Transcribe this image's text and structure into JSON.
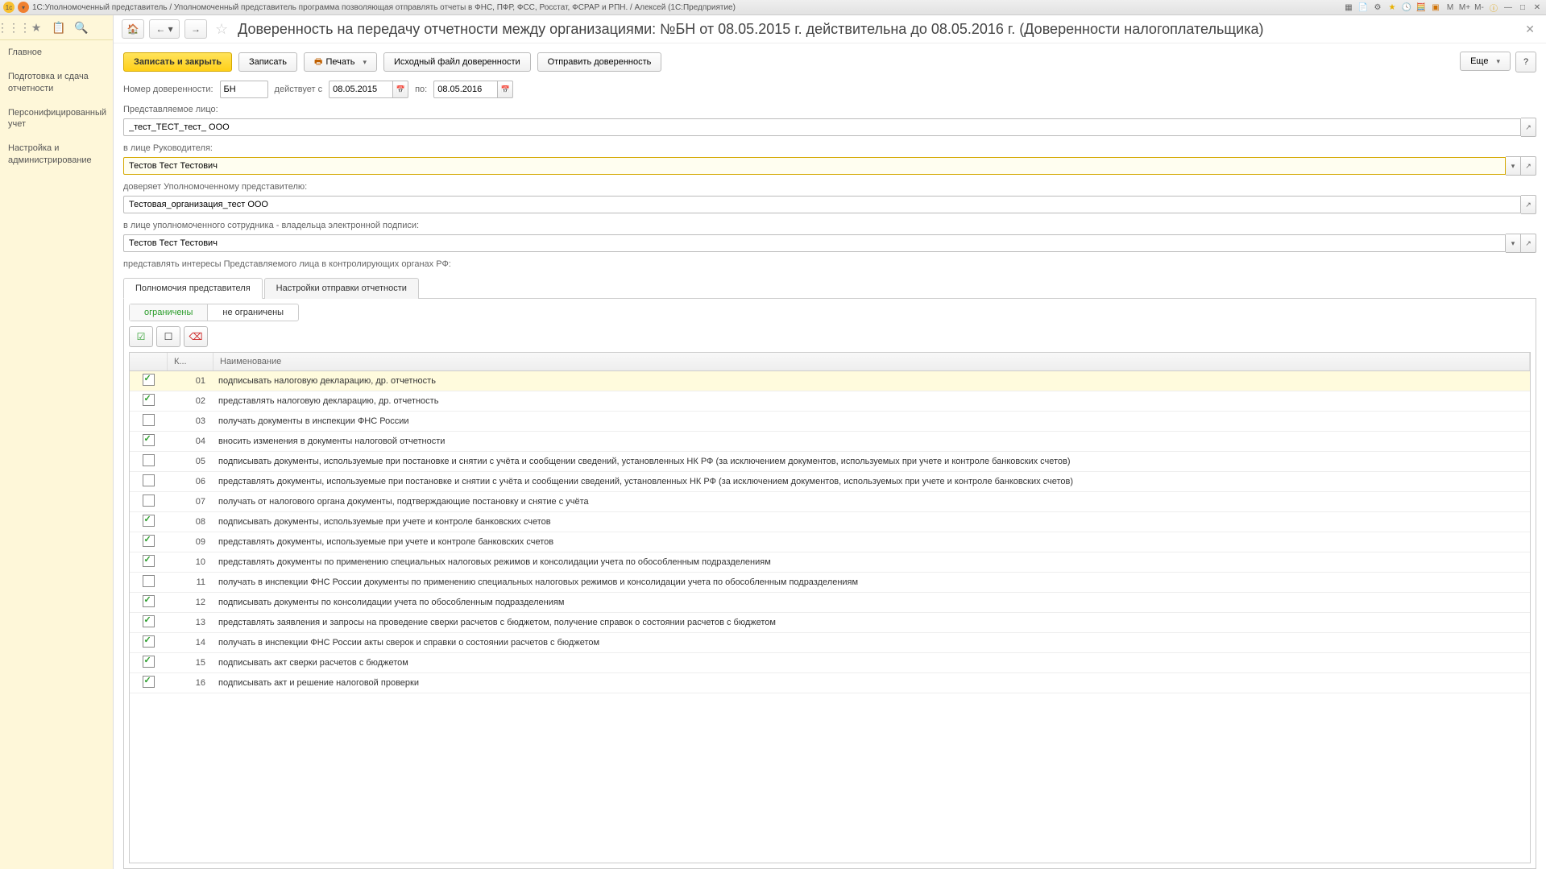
{
  "window": {
    "title": "1С:Уполномоченный представитель / Уполномоченный представитель программа позволяющая отправлять отчеты в ФНС, ПФР, ФСС, Росстат, ФСРАР и РПН. / Алексей  (1С:Предприятие)",
    "mlabels": [
      "M",
      "M+",
      "M-"
    ]
  },
  "sidebar": {
    "items": [
      "Главное",
      "Подготовка и сдача отчетности",
      "Персонифицированный учет",
      "Настройка и администрирование"
    ]
  },
  "page": {
    "title": "Доверенность на передачу отчетности между организациями: №БН от 08.05.2015 г. действительна до 08.05.2016 г. (Доверенности налогоплательщика)"
  },
  "toolbar": {
    "save_close": "Записать и закрыть",
    "save": "Записать",
    "print": "Печать",
    "source": "Исходный файл доверенности",
    "send": "Отправить доверенность",
    "more": "Еще"
  },
  "form": {
    "num_label": "Номер доверенности:",
    "num": "БН",
    "from_label": "действует с",
    "from": "08.05.2015",
    "to_label": "по:",
    "to": "08.05.2016",
    "org_label": "Представляемое лицо:",
    "org": "_тест_ТЕСТ_тест_ ООО",
    "head_label": "в лице Руководителя:",
    "head": "Тестов Тест Тестович",
    "rep_label": "доверяет Уполномоченному представителю:",
    "rep": "Тестовая_организация_тест ООО",
    "emp_label": "в лице уполномоченного сотрудника  - владельца электронной подписи:",
    "emp": "Тестов Тест Тестович",
    "interests": "представлять интересы Представляемого лица в контролирующих органах РФ:"
  },
  "tabs": {
    "t1": "Полномочия представителя",
    "t2": "Настройки отправки отчетности"
  },
  "radio": {
    "r1": "ограничены",
    "r2": "не ограничены"
  },
  "columns": {
    "c2": "К...",
    "c3": "Наименование"
  },
  "rows": [
    {
      "chk": true,
      "code": "01",
      "name": "подписывать налоговую декларацию, др. отчетность",
      "sel": true
    },
    {
      "chk": true,
      "code": "02",
      "name": "представлять налоговую декларацию, др. отчетность"
    },
    {
      "chk": false,
      "code": "03",
      "name": "получать документы в инспекции ФНС России"
    },
    {
      "chk": true,
      "code": "04",
      "name": "вносить изменения в документы налоговой отчетности"
    },
    {
      "chk": false,
      "code": "05",
      "name": "подписывать документы, используемые при постановке и снятии с учёта и сообщении сведений, установленных НК РФ (за исключением документов, используемых при  учете и контроле банковских счетов)"
    },
    {
      "chk": false,
      "code": "06",
      "name": "представлять документы, используемые при постановке и снятии с учёта и сообщении сведений, установленных НК РФ (за исключением документов,  используемых при  учете и контроле банковских счетов)"
    },
    {
      "chk": false,
      "code": "07",
      "name": "получать от налогового органа документы, подтверждающие постановку и снятие с учёта"
    },
    {
      "chk": true,
      "code": "08",
      "name": "подписывать документы, используемые при  учете и контроле банковских счетов"
    },
    {
      "chk": true,
      "code": "09",
      "name": "представлять документы, используемые при  учете и контроле банковских счетов"
    },
    {
      "chk": true,
      "code": "10",
      "name": "представлять документы по применению специальных налоговых режимов и консолидации учета по обособленным подразделениям"
    },
    {
      "chk": false,
      "code": "11",
      "name": "получать в инспекции ФНС России документы по применению специальных налоговых режимов и консолидации учета по обособленным подразделениям"
    },
    {
      "chk": true,
      "code": "12",
      "name": "подписывать документы по консолидации учета по обособленным подразделениям"
    },
    {
      "chk": true,
      "code": "13",
      "name": "представлять заявления и запросы на проведение сверки расчетов с бюджетом, получение справок о состоянии расчетов с бюджетом"
    },
    {
      "chk": true,
      "code": "14",
      "name": "получать в инспекции ФНС России акты сверок и справки о состоянии расчетов с бюджетом"
    },
    {
      "chk": true,
      "code": "15",
      "name": "подписывать акт сверки расчетов с бюджетом"
    },
    {
      "chk": true,
      "code": "16",
      "name": "подписывать акт и решение налоговой проверки"
    }
  ]
}
